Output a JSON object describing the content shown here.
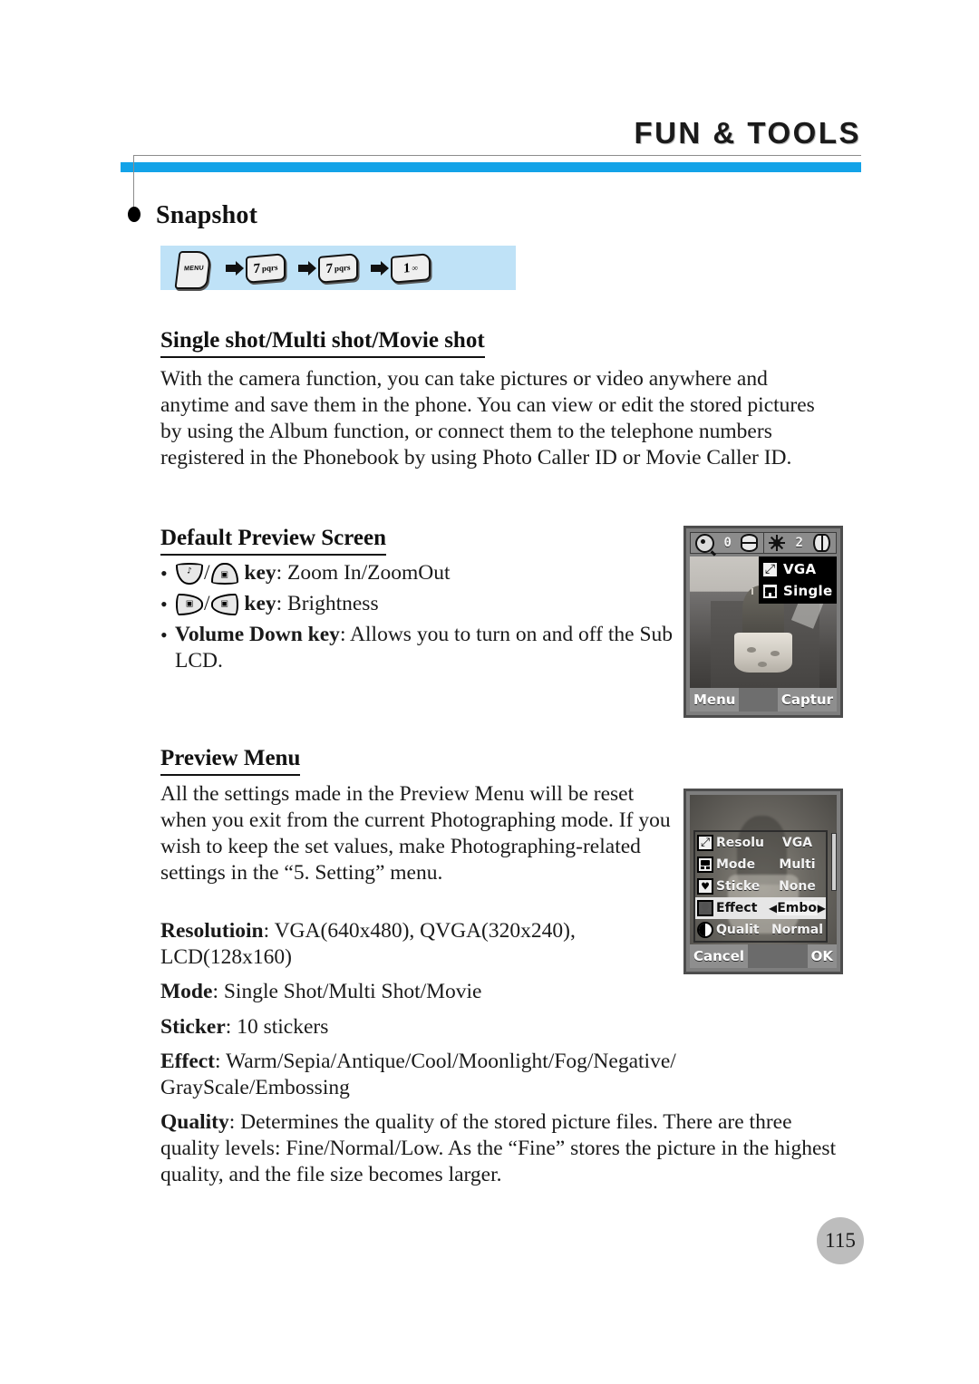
{
  "header": {
    "title": "FUN & TOOLS",
    "accent_color": "#13a3e8",
    "rule_color": "#8d8d8d"
  },
  "section": {
    "bullet_label": "Snapshot"
  },
  "key_sequence": {
    "background_color": "#bfe2f7",
    "steps": [
      {
        "type": "menu-key",
        "label": "MENU"
      },
      {
        "type": "arrow",
        "label": "➜"
      },
      {
        "type": "numeric-key",
        "digit": "7",
        "letters": "pqrs"
      },
      {
        "type": "arrow",
        "label": "➜"
      },
      {
        "type": "numeric-key",
        "digit": "7",
        "letters": "pqrs"
      },
      {
        "type": "arrow",
        "label": "➜"
      },
      {
        "type": "numeric-key",
        "digit": "1",
        "letters": "∞"
      }
    ]
  },
  "sections": {
    "single_shot": {
      "heading": "Single shot/Multi shot/Movie shot",
      "body": "With the camera function, you can take pictures or video anywhere and anytime and save them in the phone. You can view or edit the stored pictures by using the Album function, or connect them to the telephone numbers registered in the Phonebook by using Photo Caller ID or Movie Caller ID."
    },
    "default_preview": {
      "heading": "Default Preview Screen",
      "bullets": [
        {
          "keys": [
            "nav-down-key",
            "nav-up-key"
          ],
          "bold": "key",
          "text": ": Zoom In/ZoomOut"
        },
        {
          "keys": [
            "nav-right-key",
            "nav-left-key"
          ],
          "bold": "key",
          "text": ": Brightness"
        },
        {
          "bold": "Volume Down key",
          "text": ": Allows you to turn on and off the Sub LCD."
        }
      ]
    },
    "preview_menu": {
      "heading": "Preview Menu",
      "body": "All the settings made in the Preview Menu will be reset when you exit from the current Photographing mode. If you wish to keep the set values, make Photographing-related settings in the “5. Setting” menu.",
      "definitions": [
        {
          "term": "Resolutioin",
          "value": ": VGA(640x480), QVGA(320x240), LCD(128x160)"
        },
        {
          "term": "Mode",
          "value": ": Single Shot/Multi Shot/Movie"
        },
        {
          "term": "Sticker",
          "value": ": 10 stickers"
        },
        {
          "term": "Effect",
          "value": ": Warm/Sepia/Antique/Cool/Moonlight/Fog/Negative/ GrayScale/Embossing"
        },
        {
          "term": "Quality",
          "value": ": Determines the quality of the stored picture files. There are three quality levels: Fine/Normal/Low. As the “Fine” stores the picture in the highest quality, and the file size becomes larger."
        }
      ]
    }
  },
  "preview_screen": {
    "zoom_icon": "magnifier-icon",
    "zoom_value": "0",
    "zoom_adjust_icon": "up-down-arrow-icon",
    "brightness_icon": "sun-icon",
    "brightness_value": "2",
    "brightness_adjust_icon": "left-right-arrow-icon",
    "badges": [
      {
        "icon": "resolution-icon",
        "label": "VGA"
      },
      {
        "icon": "camera-mode-icon",
        "label": "Single"
      }
    ],
    "softkey_left": "Menu",
    "softkey_right": "Captur"
  },
  "preview_menu_screen": {
    "rows": [
      {
        "icon": "resolution-icon",
        "label": "Resolu",
        "value": "VGA",
        "selected": false
      },
      {
        "icon": "camera-mode-icon",
        "label": "Mode",
        "value": "Multi",
        "selected": false
      },
      {
        "icon": "sticker-icon",
        "label": "Sticke",
        "value": "None",
        "selected": false
      },
      {
        "icon": "effect-icon",
        "label": "Effect",
        "value": "Embossi",
        "selected": true
      },
      {
        "icon": "quality-icon",
        "label": "Qualit",
        "value": "Normal",
        "selected": false
      }
    ],
    "softkey_left": "Cancel",
    "softkey_right": "OK"
  },
  "footer": {
    "page_number": "115"
  }
}
